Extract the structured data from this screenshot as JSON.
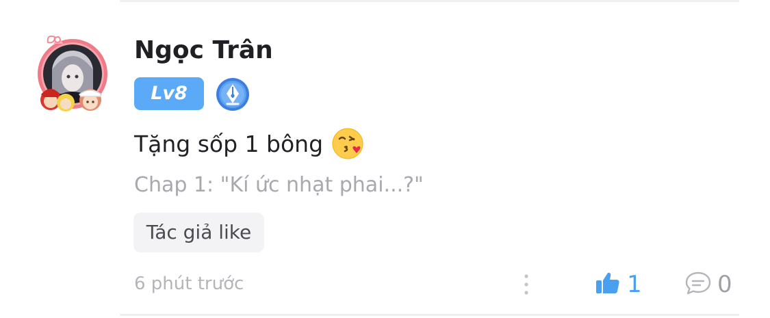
{
  "comment": {
    "user": {
      "name": "Ngọc Trân",
      "level_badge": "Lv8",
      "avatar_icon": "anime-avatar-with-frame",
      "badge_icon": "fountain-pen-badge-icon"
    },
    "text": "Tặng sốp 1 bông",
    "emoji_icon": "face-blowing-kiss-emoji",
    "chapter": "Chap 1: \"Kí ức nhạt phai...?\"",
    "author_tag": "Tác giả like",
    "timestamp": "6 phút trước",
    "likes": "1",
    "replies": "0"
  },
  "colors": {
    "level_badge_bg": "#5aaaf8",
    "like_accent": "#4aa0f0",
    "secondary_text": "#a8a8ae"
  }
}
